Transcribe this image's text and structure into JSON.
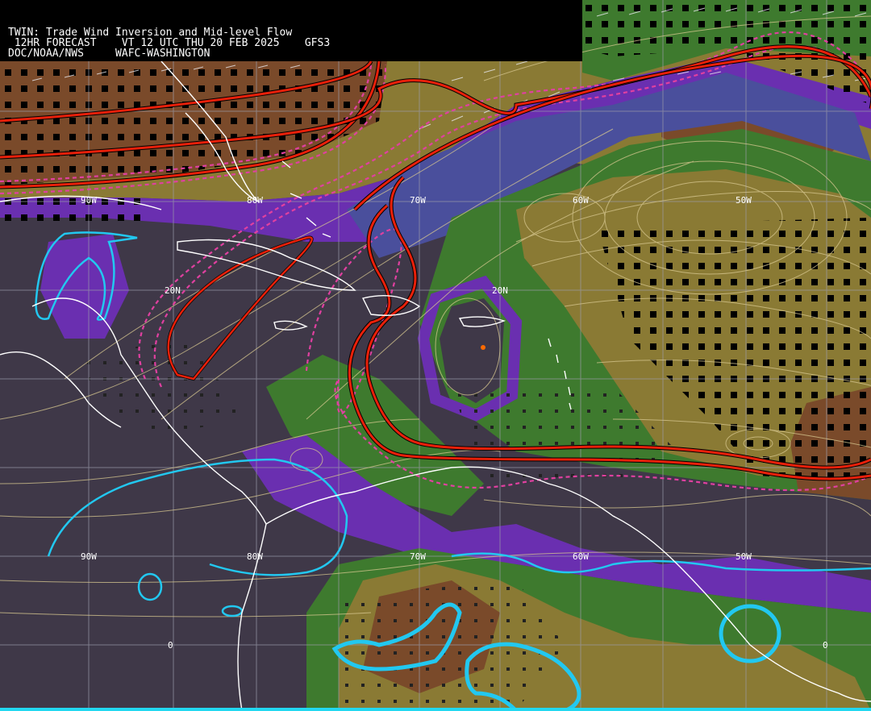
{
  "header": {
    "title": "TWIN: Trade Wind Inversion and Mid-level Flow",
    "forecast_line": " 12HR FORECAST    VT 12 UTC THU 20 FEB 2025    GFS3",
    "agency_line": "DOC/NOAA/NWS     WAFC-WASHINGTON"
  },
  "grid": {
    "lon_labels": [
      "90W",
      "80W",
      "70W",
      "60W",
      "50W"
    ],
    "lat_labels": [
      "20N",
      "20N",
      "0",
      "0"
    ],
    "lower_lon_labels": [
      "90W",
      "80W",
      "70W",
      "60W",
      "50W"
    ]
  },
  "colors": {
    "background": "#3f3848",
    "purple": "#6a2fb0",
    "blue_band": "#4a4f9c",
    "green": "#3e7a2e",
    "olive": "#8a7a34",
    "brown": "#7a4a2a",
    "inversion_line": "#e8200a",
    "dashed_contour": "#e040a0",
    "cyan_contour": "#22c8f0",
    "streamline": "#d8c890",
    "coastline": "#ffffff"
  }
}
